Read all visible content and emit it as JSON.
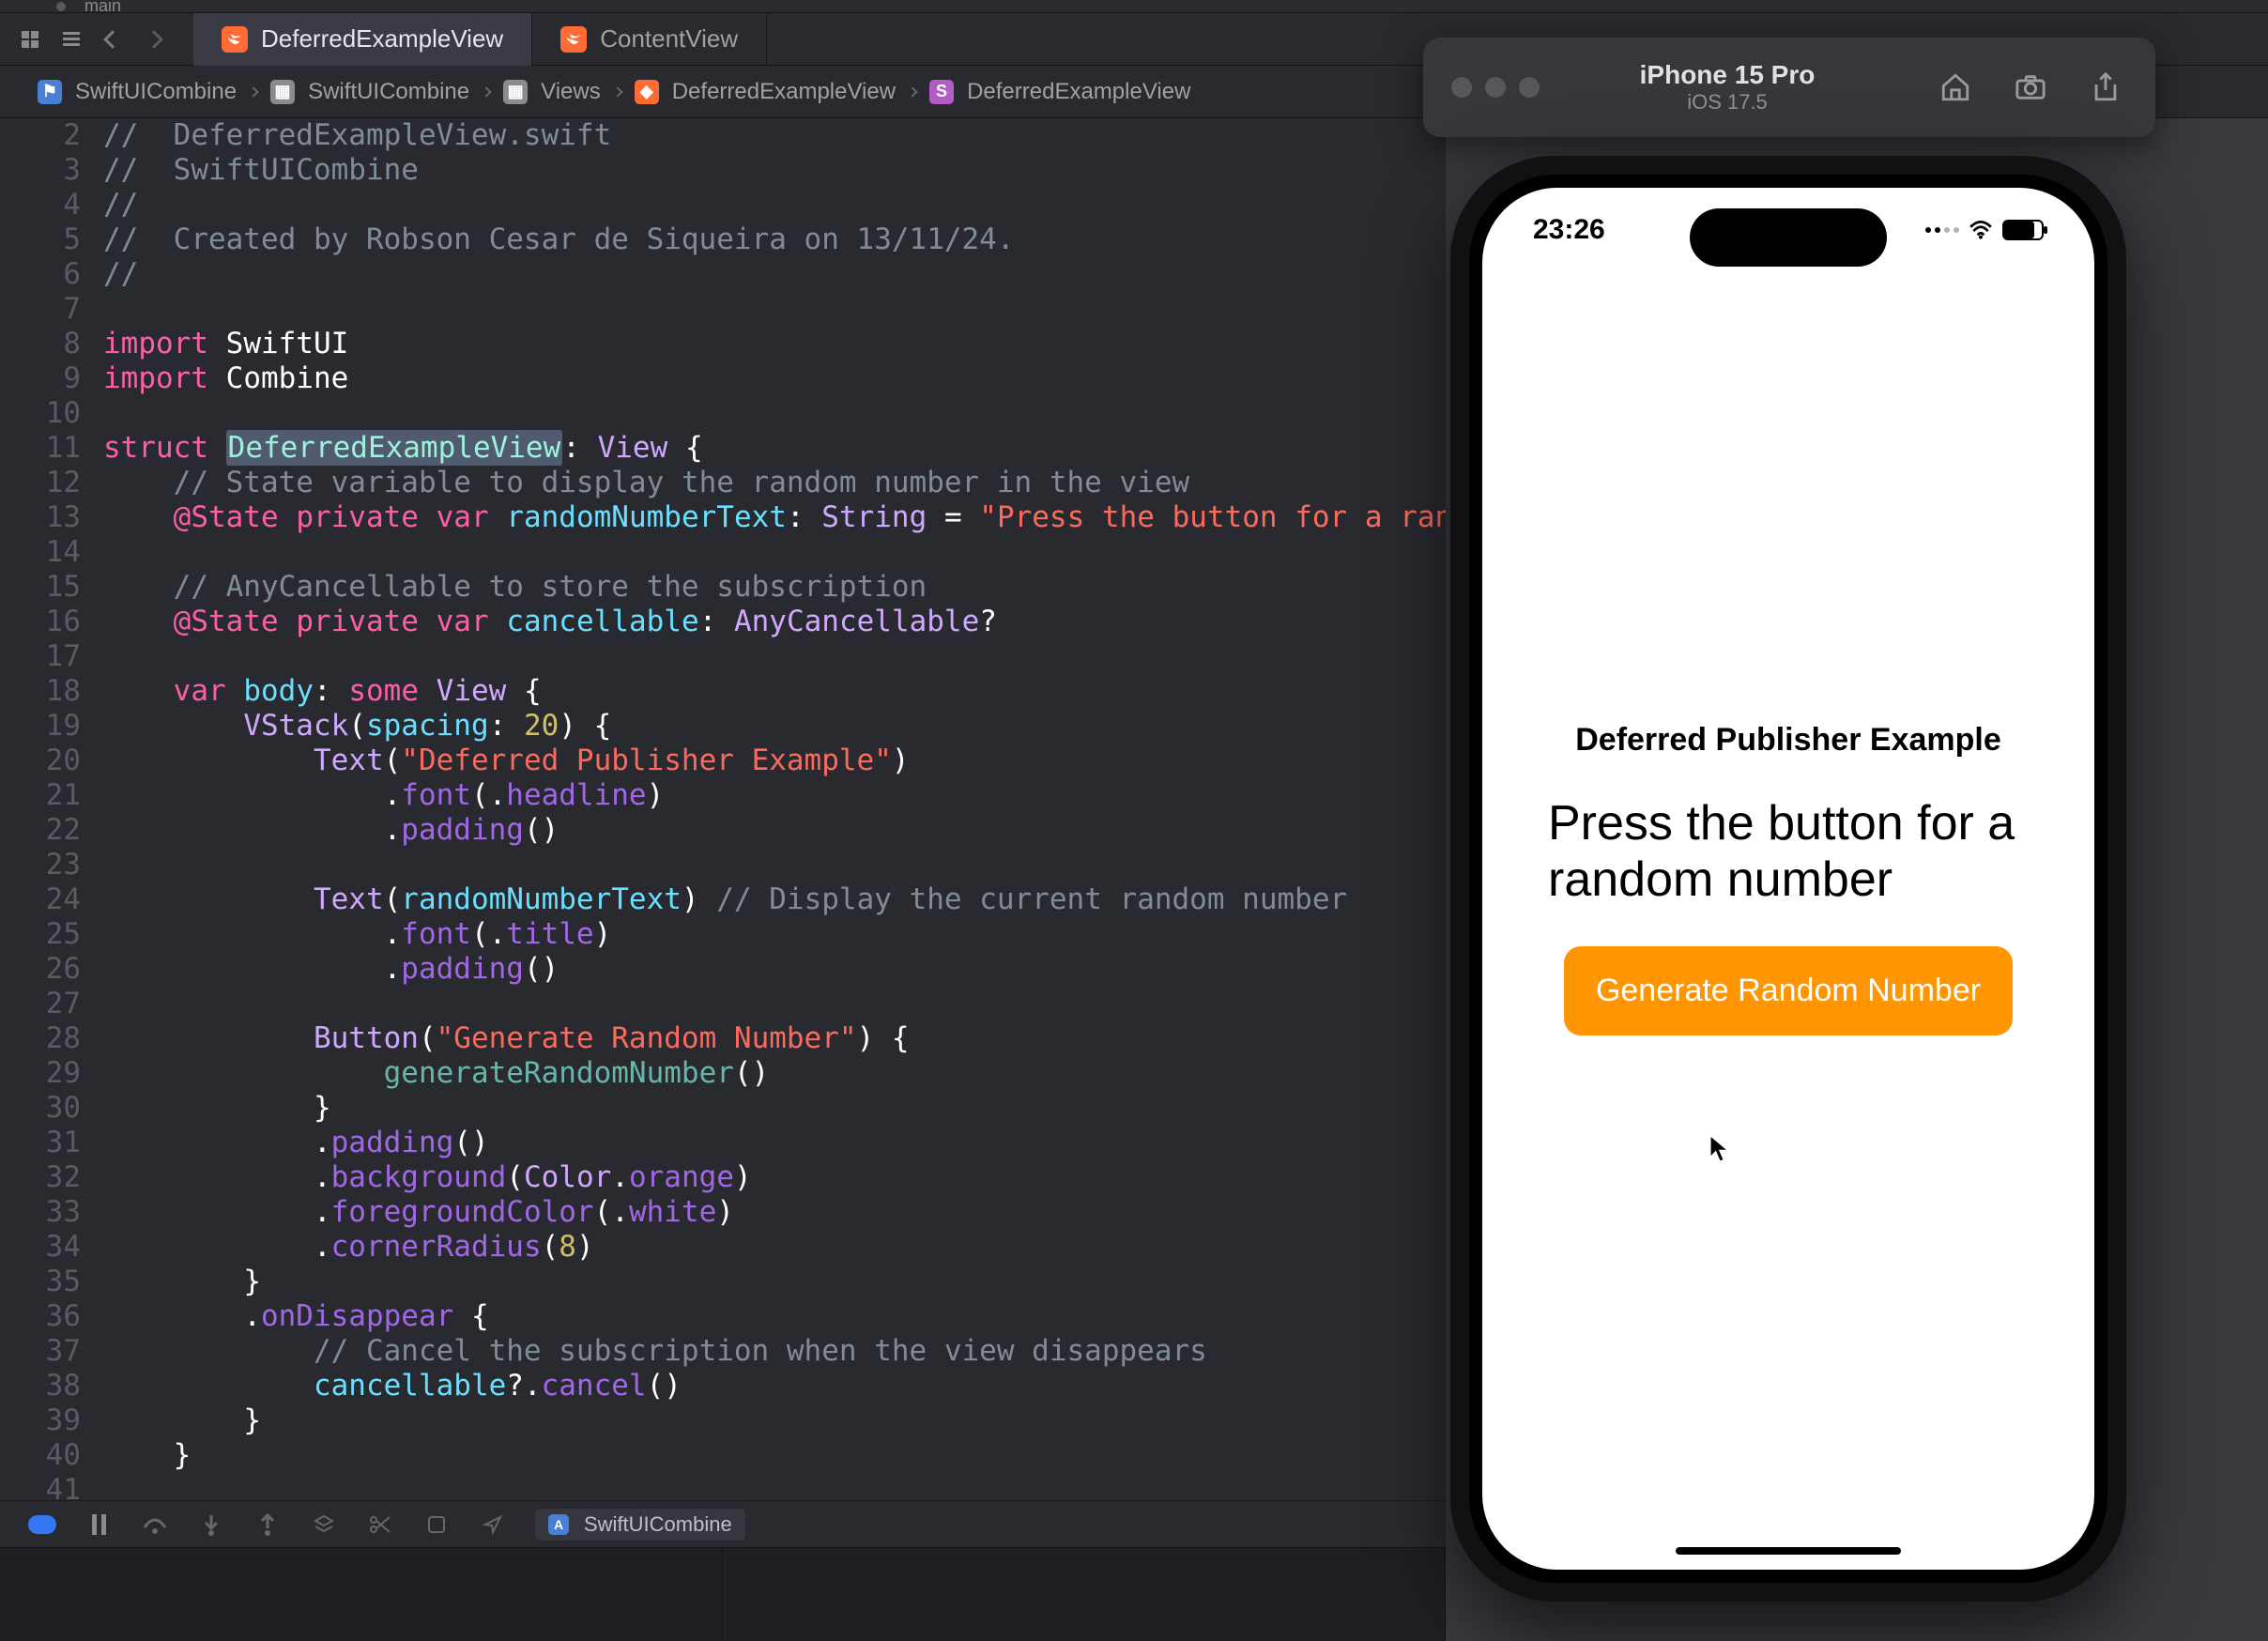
{
  "branch": {
    "name": "main"
  },
  "tabs": {
    "active": {
      "label": "DeferredExampleView"
    },
    "other": {
      "label": "ContentView"
    }
  },
  "breadcrumb": {
    "i0": "SwiftUICombine",
    "i1": "SwiftUICombine",
    "i2": "Views",
    "i3": "DeferredExampleView",
    "i4": "DeferredExampleView"
  },
  "code": {
    "l2": "//  DeferredExampleView.swift",
    "l3": "//  SwiftUICombine",
    "l4": "//",
    "l5": "//  Created by Robson Cesar de Siqueira on 13/11/24.",
    "l6": "//",
    "kw_import": "import",
    "mod_swiftui": "SwiftUI",
    "mod_combine": "Combine",
    "kw_struct": "struct",
    "struct_name": "DeferredExampleView",
    "proto_view": "View",
    "l12": "// State variable to display the random number in the view",
    "at_state": "@State",
    "kw_private": "private",
    "kw_var": "var",
    "id_random": "randomNumberText",
    "ty_string": "String",
    "str_press": "\"Press the button for a random numbe",
    "l15": "// AnyCancellable to store the subscription",
    "id_cancellable": "cancellable",
    "ty_anycancel": "AnyCancellable",
    "id_body": "body",
    "kw_some": "some",
    "ty_vstack": "VStack",
    "arg_spacing": "spacing",
    "n20": "20",
    "fn_text": "Text",
    "str_headline": "\"Deferred Publisher Example\"",
    "fn_font": "font",
    "en_headline": "headline",
    "fn_padding": "padding",
    "c24": "// Display the current random number",
    "en_title": "title",
    "fn_button": "Button",
    "str_btn": "\"Generate Random Number\"",
    "fn_gen": "generateRandomNumber",
    "fn_bg": "background",
    "ty_color": "Color",
    "id_orange": "orange",
    "fn_fg": "foregroundColor",
    "en_white": "white",
    "fn_corner": "cornerRadius",
    "n8": "8",
    "fn_ondis": "onDisappear",
    "c37": "// Cancel the subscription when the view disappears",
    "fn_cancel": "cancel",
    "lines": {
      "n2": "2",
      "n3": "3",
      "n4": "4",
      "n5": "5",
      "n6": "6",
      "n7": "7",
      "n8": "8",
      "n9": "9",
      "n10": "10",
      "n11": "11",
      "n12": "12",
      "n13": "13",
      "n14": "14",
      "n15": "15",
      "n16": "16",
      "n17": "17",
      "n18": "18",
      "n19": "19",
      "n20": "20",
      "n21": "21",
      "n22": "22",
      "n23": "23",
      "n24": "24",
      "n25": "25",
      "n26": "26",
      "n27": "27",
      "n28": "28",
      "n29": "29",
      "n30": "30",
      "n31": "31",
      "n32": "32",
      "n33": "33",
      "n34": "34",
      "n35": "35",
      "n36": "36",
      "n37": "37",
      "n38": "38",
      "n39": "39",
      "n40": "40",
      "n41": "41"
    }
  },
  "debug": {
    "target": "SwiftUICombine"
  },
  "simulator": {
    "device": "iPhone 15 Pro",
    "os": "iOS 17.5",
    "status_time": "23:26"
  },
  "app": {
    "heading": "Deferred Publisher Example",
    "body": "Press the button for a random number",
    "button": "Generate Random Number"
  }
}
